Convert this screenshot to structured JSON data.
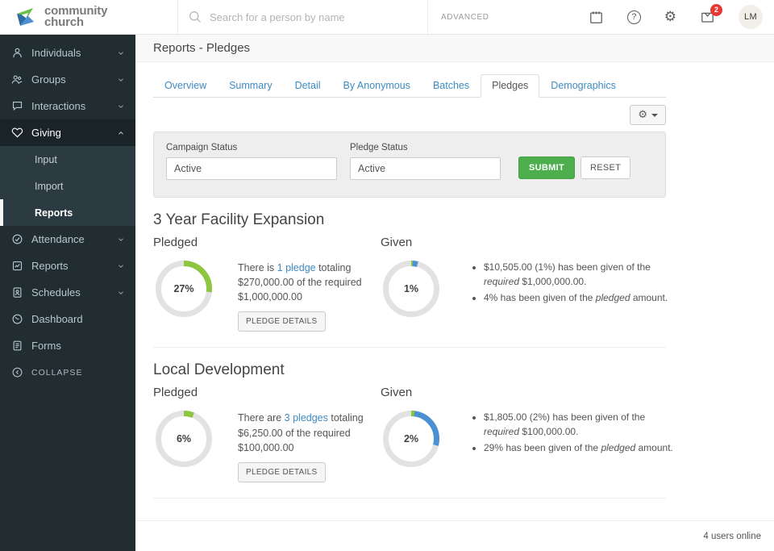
{
  "topbar": {
    "logo_line1": "community",
    "logo_line2": "church",
    "search_placeholder": "Search for a person by name",
    "advanced_label": "ADVANCED",
    "mail_badge": "2",
    "avatar_initials": "LM"
  },
  "sidebar": {
    "items": [
      {
        "label": "Individuals"
      },
      {
        "label": "Groups"
      },
      {
        "label": "Interactions"
      },
      {
        "label": "Giving"
      },
      {
        "label": "Attendance"
      },
      {
        "label": "Reports"
      },
      {
        "label": "Schedules"
      },
      {
        "label": "Dashboard"
      },
      {
        "label": "Forms"
      }
    ],
    "giving_subitems": [
      {
        "label": "Input"
      },
      {
        "label": "Import"
      },
      {
        "label": "Reports"
      }
    ],
    "collapse_label": "COLLAPSE"
  },
  "header": {
    "title": "Reports - Pledges"
  },
  "tabs": {
    "items": [
      {
        "label": "Overview"
      },
      {
        "label": "Summary"
      },
      {
        "label": "Detail"
      },
      {
        "label": "By Anonymous"
      },
      {
        "label": "Batches"
      },
      {
        "label": "Pledges"
      },
      {
        "label": "Demographics"
      }
    ],
    "active": "Pledges"
  },
  "filters": {
    "campaign_status_label": "Campaign Status",
    "campaign_status_value": "Active",
    "pledge_status_label": "Pledge Status",
    "pledge_status_value": "Active",
    "submit_label": "SUBMIT",
    "reset_label": "RESET"
  },
  "colors": {
    "green": "#8cc63e",
    "blue": "#4a90d2",
    "ring": "#e2e2e2",
    "submit_green": "#4cae4c",
    "badge_red": "#e53935"
  },
  "campaigns": [
    {
      "name": "3 Year Facility Expansion",
      "pledged": {
        "label": "Pledged",
        "donut": {
          "label": "27%",
          "segments": [
            {
              "color": "#8cc63e",
              "pct": 27
            }
          ]
        },
        "text_prefix": "There is ",
        "text_link": "1 pledge",
        "text_suffix": " totaling $270,000.00 of the required $1,000,000.00",
        "details_button": "PLEDGE DETAILS"
      },
      "given": {
        "label": "Given",
        "donut": {
          "label": "1%",
          "segments": [
            {
              "color": "#4a90d2",
              "pct": 4
            },
            {
              "color": "#8cc63e",
              "pct": 1
            }
          ]
        },
        "bullets": [
          {
            "pre": "$10,505.00 (1%) has been given of the ",
            "em": "required",
            "post": " $1,000,000.00."
          },
          {
            "pre": "4% has been given of the ",
            "em": "pledged",
            "post": " amount."
          }
        ]
      }
    },
    {
      "name": "Local Development",
      "pledged": {
        "label": "Pledged",
        "donut": {
          "label": "6%",
          "segments": [
            {
              "color": "#8cc63e",
              "pct": 6
            }
          ]
        },
        "text_prefix": "There are ",
        "text_link": "3 pledges",
        "text_suffix": " totaling $6,250.00 of the required $100,000.00",
        "details_button": "PLEDGE DETAILS"
      },
      "given": {
        "label": "Given",
        "donut": {
          "label": "2%",
          "segments": [
            {
              "color": "#4a90d2",
              "pct": 29
            },
            {
              "color": "#8cc63e",
              "pct": 2
            }
          ]
        },
        "bullets": [
          {
            "pre": "$1,805.00 (2%) has been given of the ",
            "em": "required",
            "post": " $100,000.00."
          },
          {
            "pre": "29% has been given of the ",
            "em": "pledged",
            "post": " amount."
          }
        ]
      }
    }
  ],
  "footer": {
    "users_online": "4 users online"
  }
}
